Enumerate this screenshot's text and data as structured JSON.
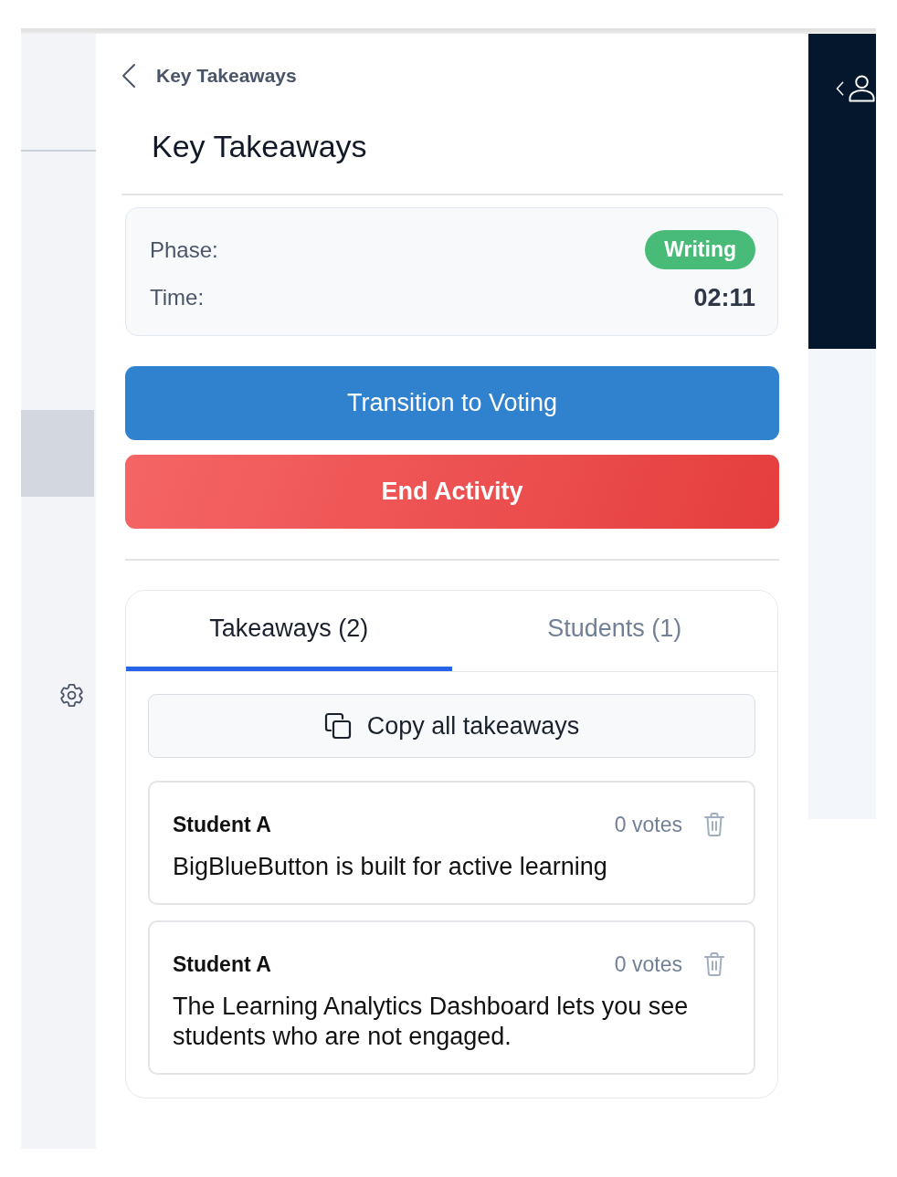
{
  "header": {
    "back_label": "Key Takeaways",
    "title": "Key Takeaways"
  },
  "status": {
    "phase_label": "Phase:",
    "phase": "Writing",
    "time_label": "Time:",
    "time": "02:11"
  },
  "actions": [
    {
      "kind": "primary",
      "label": "Transition to Voting"
    },
    {
      "kind": "danger",
      "label": "End Activity"
    }
  ],
  "tabs": [
    {
      "label": "Takeaways (2)",
      "selected": true
    },
    {
      "label": "Students (1)",
      "selected": false
    }
  ],
  "copy_button": {
    "label": "Copy all takeaways"
  },
  "takeaways": [
    {
      "author": "Student A",
      "votes": "0 votes",
      "text": "BigBlueButton is built for active learning"
    },
    {
      "author": "Student A",
      "votes": "0 votes",
      "text": "The Learning Analytics Dashboard lets you see students who are not engaged."
    }
  ]
}
